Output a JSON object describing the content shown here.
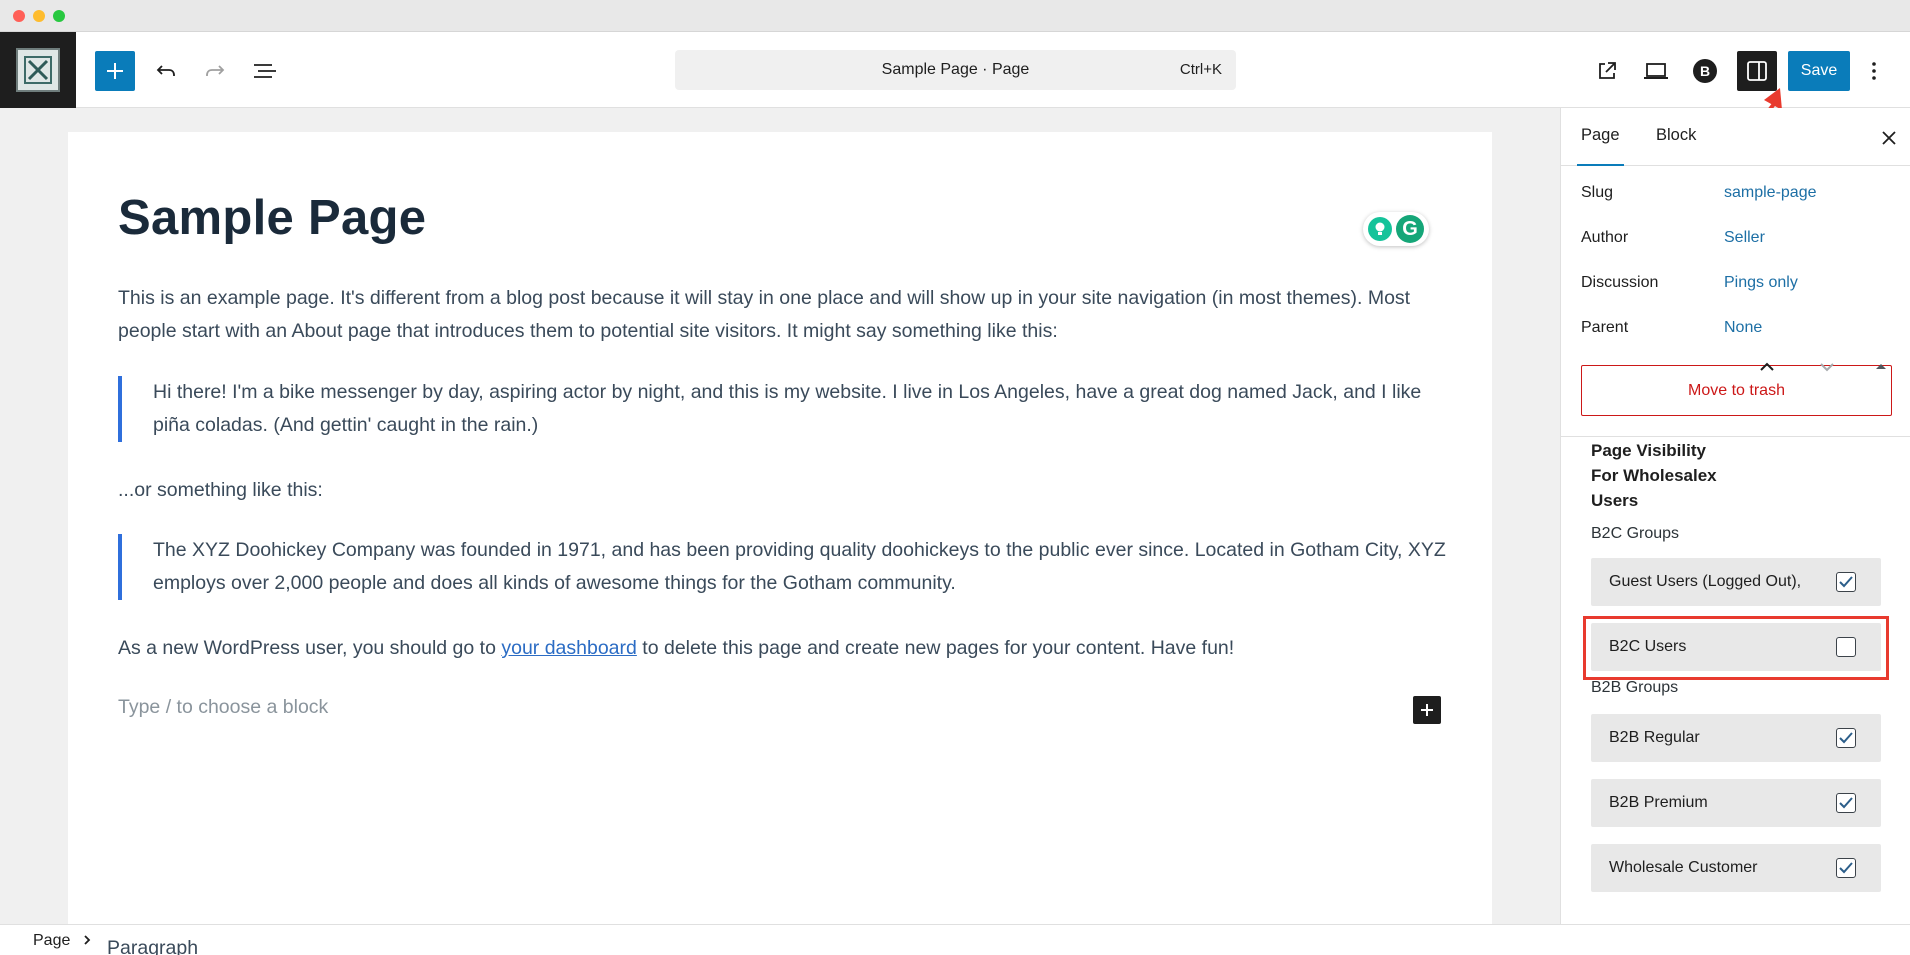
{
  "header": {
    "command_title": "Sample Page · Page",
    "command_shortcut": "Ctrl+K",
    "save_label": "Save"
  },
  "post": {
    "title": "Sample Page",
    "paragraph1": "This is an example page. It's different from a blog post because it will stay in one place and will show up in your site navigation (in most themes). Most people start with an About page that introduces them to potential site visitors. It might say something like this:",
    "quote1": "Hi there! I'm a bike messenger by day, aspiring actor by night, and this is my website. I live in Los Angeles, have a great dog named Jack, and I like piña coladas. (And gettin' caught in the rain.)",
    "paragraph2": "...or something like this:",
    "quote2": "The XYZ Doohickey Company was founded in 1971, and has been providing quality doohickeys to the public ever since. Located in Gotham City, XYZ employs over 2,000 people and does all kinds of awesome things for the Gotham community.",
    "paragraph3_before": "As a new WordPress user, you should go to ",
    "paragraph3_link": "your dashboard",
    "paragraph3_after": " to delete this page and create new pages for your content. Have fun!",
    "block_placeholder": "Type / to choose a block"
  },
  "sidebar": {
    "tabs": {
      "page": "Page",
      "block": "Block"
    },
    "meta": {
      "slug_label": "Slug",
      "slug_value": "sample-page",
      "author_label": "Author",
      "author_value": "Seller",
      "discussion_label": "Discussion",
      "discussion_value": "Pings only",
      "parent_label": "Parent",
      "parent_value": "None"
    },
    "trash_label": "Move to trash",
    "visibility": {
      "title": "Page Visibility For Wholesalex Users",
      "b2c_label": "B2C Groups",
      "b2c_options": [
        {
          "label": "Guest Users (Logged Out),",
          "checked": true
        },
        {
          "label": "B2C Users",
          "checked": false
        }
      ],
      "b2b_label": "B2B Groups",
      "b2b_options": [
        {
          "label": "B2B Regular",
          "checked": true
        },
        {
          "label": "B2B Premium",
          "checked": true
        },
        {
          "label": "Wholesale Customer",
          "checked": true
        }
      ]
    }
  },
  "footer": {
    "breadcrumb_page": "Page",
    "breadcrumb_block": "Paragraph"
  },
  "colors": {
    "accent": "#0a7cba",
    "annotation": "#e83a2e",
    "danger": "#cc1818",
    "quote_border": "#2f6fdc"
  }
}
